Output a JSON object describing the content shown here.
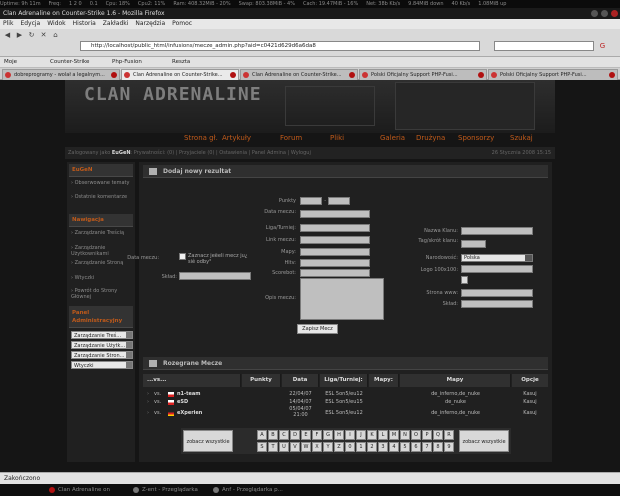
{
  "system_bar": [
    "Uptime: 9h 11m",
    "Freq:",
    "1 2 0",
    "0.1",
    "Cpu: 18%",
    "Cpu2: 11%",
    "Ram: 408.32MiB - 20%",
    "Swap: 803.38MiB - 4%",
    "Cach: 19.47MiB - 16%",
    "Net: 38b Kb/s",
    "9.84MiB down",
    "40 Kb/s",
    "1.08MiB up"
  ],
  "window_title": "Clan Adrenaline on Counter-Strike 1.6 - Mozilla Firefox",
  "menu": [
    "Plik",
    "Edycja",
    "Widok",
    "Historia",
    "Zakładki",
    "Narzędzia",
    "Pomoc"
  ],
  "url": "http://localhost/public_html/infusions/mecze_admin.php?aid=c0421d629d6a6da8",
  "bookmarks": [
    "Moje",
    "Counter-Strike",
    "Php-Fusion",
    "Reszta"
  ],
  "tabs": [
    "dobreprogramy - wolał a legalnym...",
    "Clan Adrenaline on Counter-Strike...",
    "Clan Adrenaline on Counter-Strike...",
    "Polski Oficjalny Support PHP-Fusi...",
    "Polski Oficjalny Support PHP-Fusi..."
  ],
  "logo_text": "CLAN ADRENALINE",
  "topnav": [
    "Strona gł.",
    "Artykuły",
    "Forum",
    "Pliki",
    "Galeria",
    "Drużyna",
    "Sponsorzy",
    "Szukaj"
  ],
  "infobar": {
    "prefix": "Zalogowany jako",
    "user": "EuGeN",
    "rest": ": Prywatności: (0) | Przyjaciele (0) | Ostawienia | Panel Admina | Wyloguj",
    "date": "26 Stycznia 2008 15:15"
  },
  "sidebar": {
    "user_title": "EuGeN",
    "user_links": [
      "Obserwowane tematy",
      "Ostatnie komentarze"
    ],
    "nav_title": "Nawigacja",
    "nav_links": [
      "Zarządzanie Treścią",
      "Zarządzanie Użytkownikami",
      "Zarządzanie Stroną",
      "Wtyczki"
    ],
    "back_link": "Powrót do Strony Głównej",
    "admin_title": "Panel Administracyjny",
    "admin_selects": [
      "Zarządzanie Treś...",
      "Zarządzanie Użytk...",
      "Zarządzanie Stron...",
      "Wtyczki"
    ]
  },
  "form": {
    "title": "Dodaj nowy rezultat",
    "left_labels": [
      "Punkty",
      "Data meczu:",
      "Liga/Turniej:",
      "Link meczu:",
      "Mapy:",
      "Hltv:",
      "Scorebot:",
      "Opis meczu:"
    ],
    "date_label": "Data meczu:",
    "date_checkbox": "Zaznacz jeëeli mecz ju¿ siê odby³",
    "sklad_left": "Skład:",
    "right_labels": [
      "Nazwa Klanu:",
      "Tag/skrót klanu:",
      "Narodowość:",
      "Logo 100x100:",
      "Strona www:",
      "Skład:"
    ],
    "country": "Polska",
    "submit": "Zapisz Mecz"
  },
  "matches": {
    "title": "Rozegrane Mecze",
    "headers": [
      "...vs...",
      "Punkty",
      "Data",
      "Liga/Turniej:",
      "Mapy:",
      "Mapy",
      "Opcje"
    ],
    "rows": [
      {
        "team": "n1-team",
        "date": "22/04/07",
        "league": "ESL 5on5/eu12",
        "maps": "de_inferno,de_nuke",
        "opt": "Kasuj",
        "flag": "pl"
      },
      {
        "team": "eSD",
        "date": "14/04/07",
        "league": "ESL 5on5/eu15",
        "maps": "de_nuke",
        "opt": "Kasuj",
        "flag": "pl"
      },
      {
        "team": "eXperien",
        "date": "05/04/07 21:00",
        "league": "ESL 5on5/eu12",
        "maps": "de_inferno,de_nuke",
        "opt": "Kasuj",
        "flag": "de"
      }
    ],
    "vs": "vs.",
    "show_all": "zobacz wszystkie",
    "letters1": [
      "A",
      "B",
      "C",
      "D",
      "E",
      "F",
      "G",
      "H",
      "I",
      "J",
      "K",
      "L",
      "M",
      "N",
      "O",
      "P",
      "Q",
      "R"
    ],
    "letters2": [
      "S",
      "T",
      "U",
      "V",
      "W",
      "X",
      "Y",
      "Z",
      "0",
      "1",
      "2",
      "3",
      "4",
      "5",
      "6",
      "7",
      "8",
      "9"
    ]
  },
  "status": "Zakończono",
  "taskbar": [
    "Clan Adrenaline on",
    "Z-ent - Przeglądarka",
    "Anf - Przeglądarka p..."
  ]
}
